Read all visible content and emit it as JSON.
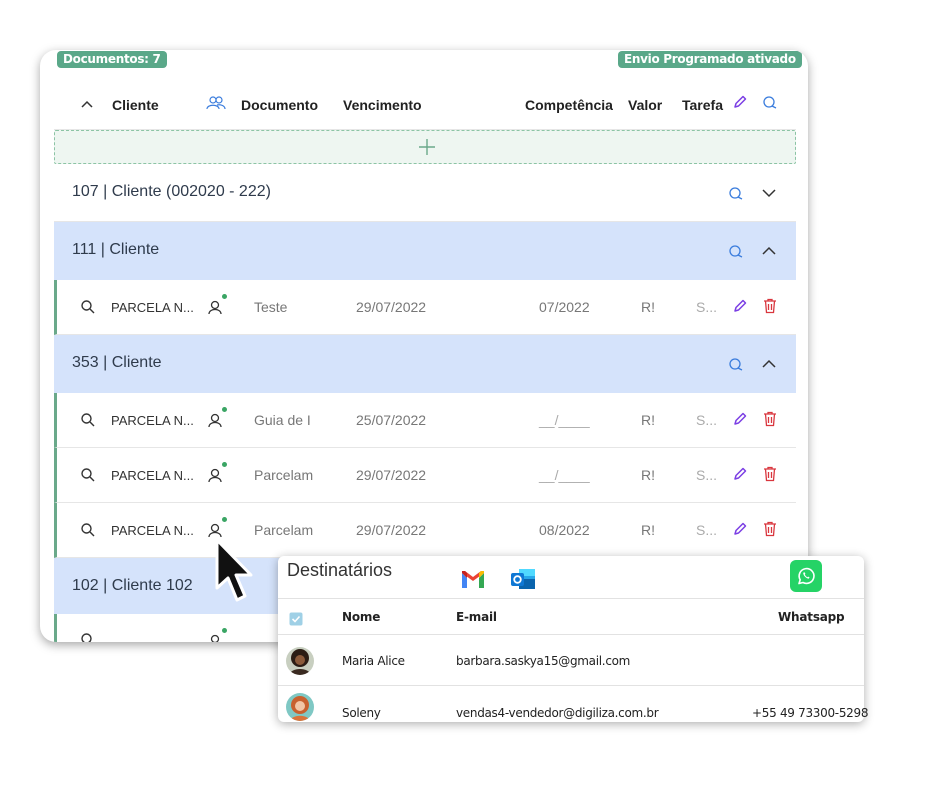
{
  "badges": {
    "documentos": "Documentos: 7",
    "envio": "Envio Programado ativado"
  },
  "columns": {
    "cliente": "Cliente",
    "documento": "Documento",
    "vencimento": "Vencimento",
    "competencia": "Competência",
    "valor": "Valor",
    "tarefa": "Tarefa"
  },
  "groups": [
    {
      "title": "107 | Cliente  (002020 - 222)",
      "rows": []
    },
    {
      "title": "111 | Cliente",
      "rows": [
        {
          "tipo": "PARCELA N...",
          "documento": "Teste",
          "vencimento": "29/07/2022",
          "competencia": "07/2022",
          "valor": "R!",
          "tarefa": "S..."
        }
      ]
    },
    {
      "title": "353 | Cliente",
      "rows": [
        {
          "tipo": "PARCELA N...",
          "documento": "Guia de I",
          "vencimento": "25/07/2022",
          "competencia": "__/____",
          "valor": "R!",
          "tarefa": "S..."
        },
        {
          "tipo": "PARCELA N...",
          "documento": "Parcelam",
          "vencimento": "29/07/2022",
          "competencia": "__/____",
          "valor": "R!",
          "tarefa": "S..."
        },
        {
          "tipo": "PARCELA N...",
          "documento": "Parcelam",
          "vencimento": "29/07/2022",
          "competencia": "08/2022",
          "valor": "R!",
          "tarefa": "S..."
        }
      ]
    },
    {
      "title": "102 | Cliente 102",
      "rows": []
    }
  ],
  "popup": {
    "title": "Destinatários",
    "columns": {
      "nome": "Nome",
      "email": "E-mail",
      "whatsapp": "Whatsapp"
    },
    "recipients": [
      {
        "nome": "Maria Alice",
        "email": "barbara.saskya15@gmail.com",
        "whatsapp": ""
      },
      {
        "nome": "Soleny",
        "email": "vendas4-vendedor@digiliza.com.br",
        "whatsapp": "+55 49 73300-5298"
      }
    ]
  },
  "colors": {
    "accent_green": "#5aa889",
    "group_blue": "#d5e3fb",
    "icon_blue": "#3b7ddd",
    "edit_purple": "#7b3fe4",
    "delete_red": "#d9363e",
    "whatsapp_green": "#25d366"
  }
}
